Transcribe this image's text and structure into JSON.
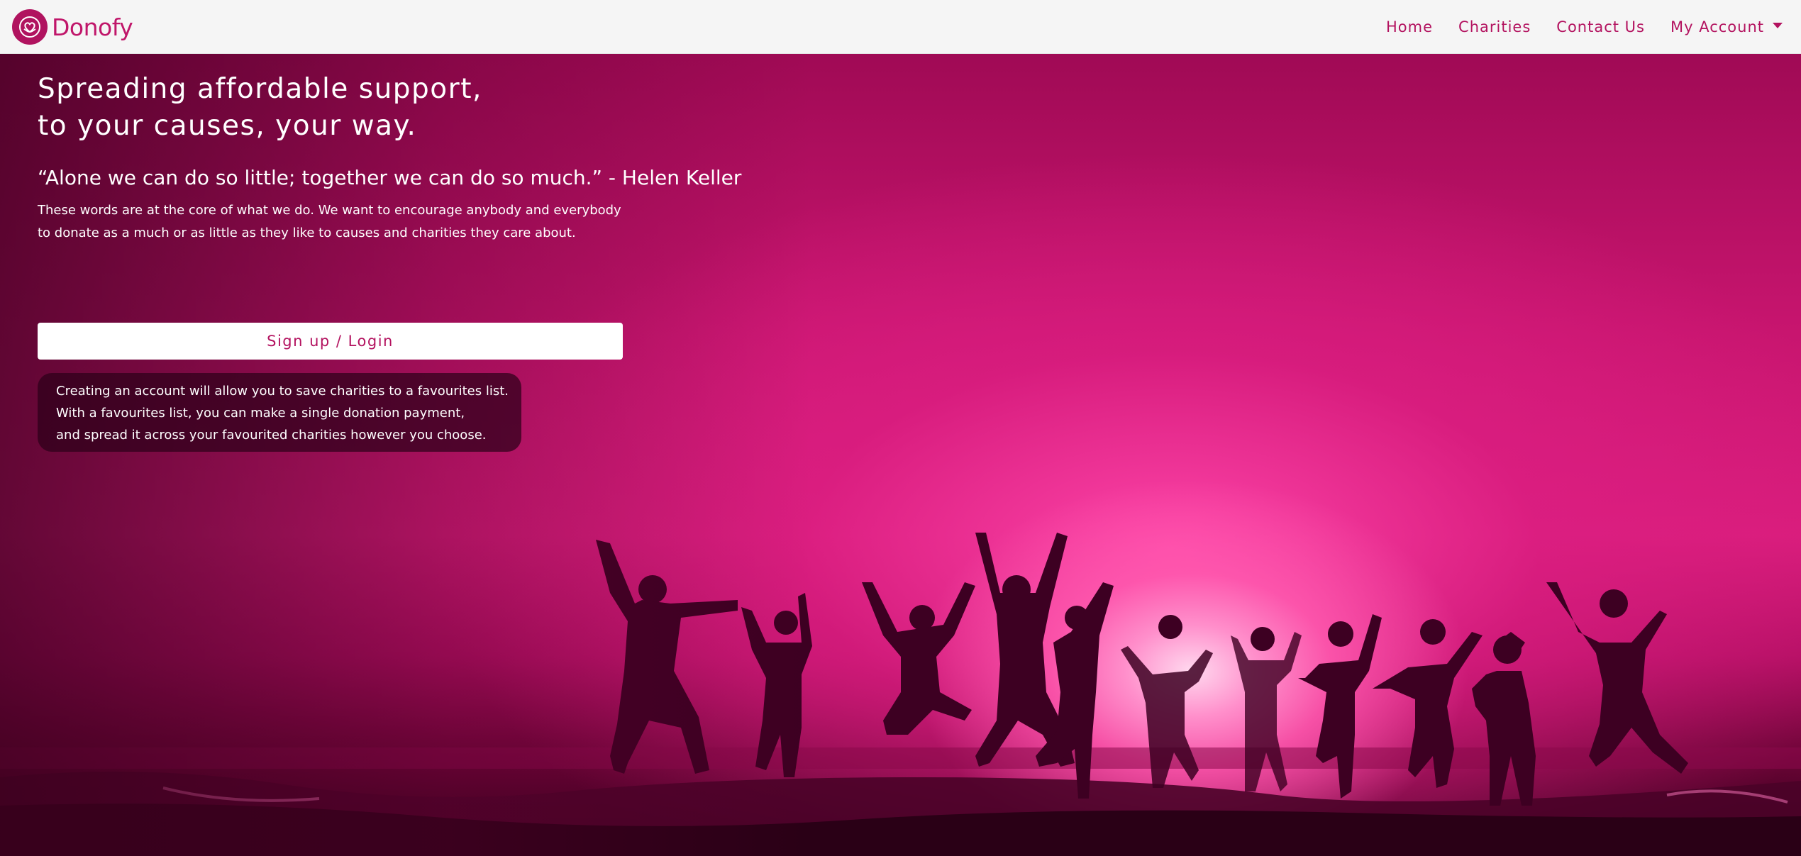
{
  "brand": {
    "name": "Donofy",
    "logo_icon": "heart-hands-icon",
    "accent_color": "#c0166a"
  },
  "nav": {
    "items": [
      {
        "label": "Home"
      },
      {
        "label": "Charities"
      },
      {
        "label": "Contact Us"
      },
      {
        "label": "My Account",
        "has_dropdown": true
      }
    ]
  },
  "hero": {
    "headline_line1": "Spreading affordable support,",
    "headline_line2": "to your causes, your way.",
    "quote": "“Alone we can do so little; together we can do so much.” - Helen Keller",
    "description_line1": "These words are at the core of what we do. We want to encourage anybody and everybody",
    "description_line2": "to donate as a much or as little as they like to causes and charities they care about.",
    "cta_label": "Sign up / Login",
    "info_lines": [
      "Creating an account will allow you to save charities to a favourites list.",
      "With a favourites list, you can make a single donation payment,",
      "and spread it across your favourited charities however you choose."
    ]
  }
}
